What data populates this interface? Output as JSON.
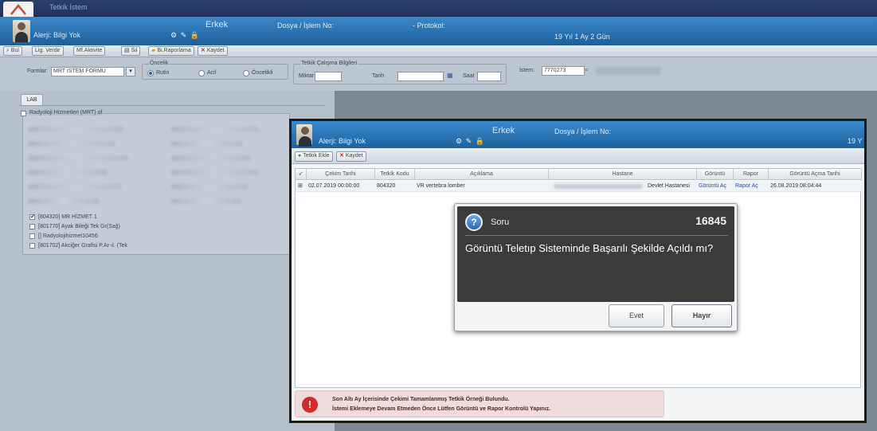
{
  "window": {
    "title": "Tetkik İstem"
  },
  "patient": {
    "name": "Alerji: Bilgi Yok",
    "gender": "Erkek",
    "file_label": "Dosya / İşlem No:",
    "protocol_label": "- Protokol:",
    "age": "19 Yıl 1 Ay 2 Gün"
  },
  "toolbar": {
    "items": [
      "Bul",
      "Lig. Verdir",
      "Mf.Aktivite",
      "Sil",
      "Bi.Raporlama",
      "Kaydet"
    ]
  },
  "filter": {
    "form_label": "Formlar:",
    "form_value": "MRT İSTEM FORMU",
    "priority_group": "Öncelik",
    "priority_options": [
      "Rutin",
      "Acil",
      "Öncelikli"
    ],
    "priority_selected": "Rutin",
    "proc_group": "Tetkik Çalışma Bilgileri",
    "miktar_label": "Miktar",
    "tarih_label": "Tarih",
    "saat_label": "Saat",
    "istem_label": "İstem:",
    "istem_value": "7770273"
  },
  "left": {
    "tab": "LAB",
    "group_title": "Radyoloji Hizmetleri (MRT) of",
    "items": [
      {
        "checked": true,
        "label": "[804320] MR HİZMET 1"
      },
      {
        "checked": false,
        "label": "[801770] Ayak Bileği Tek Gr(Sağ)"
      },
      {
        "checked": false,
        "label": "[] Radyolojihizmet10456"
      },
      {
        "checked": false,
        "label": "[801702] Akciğer Grafisi P.Ar-ıl. (Tek"
      }
    ]
  },
  "modal": {
    "header": {
      "name": "Alerji: Bilgi Yok",
      "gender": "Erkek",
      "file_label": "Dosya / İşlem No:",
      "age_partial": "19 Y"
    },
    "toolbar": {
      "select_label": "Tetkik Ekle",
      "save_label": "Kaydet"
    },
    "grid": {
      "columns": [
        "Çekim Tarihi",
        "Tetkik Kodu",
        "Açıklama",
        "Hastane",
        "Görüntü",
        "Rapor",
        "Görüntü Açma Tarihi"
      ],
      "rows": [
        {
          "date": "02.07.2019 00:00:00",
          "code": "804320",
          "desc": "VR vertebra lomber",
          "hospital": "Devlet Hastanesi",
          "view": "Görüntü Aç",
          "report": "Rapor Aç",
          "opened": "26.08.2019 08:04:44"
        }
      ]
    },
    "warning": {
      "line1": "Son Altı Ay İçerisinde Çekimi Tamamlanmış Tetkik Örneği Bulundu.",
      "line2": "İstemi Eklemeye Devam Etmeden Önce Lütfen Görüntü ve Rapor Kontrolü Yapınız."
    }
  },
  "dialog": {
    "title": "Soru",
    "code": "16845",
    "message": "Görüntü Teletıp Sisteminde Başarılı Şekilde Açıldı mı?",
    "yes": "Evet",
    "no": "Hayır"
  }
}
